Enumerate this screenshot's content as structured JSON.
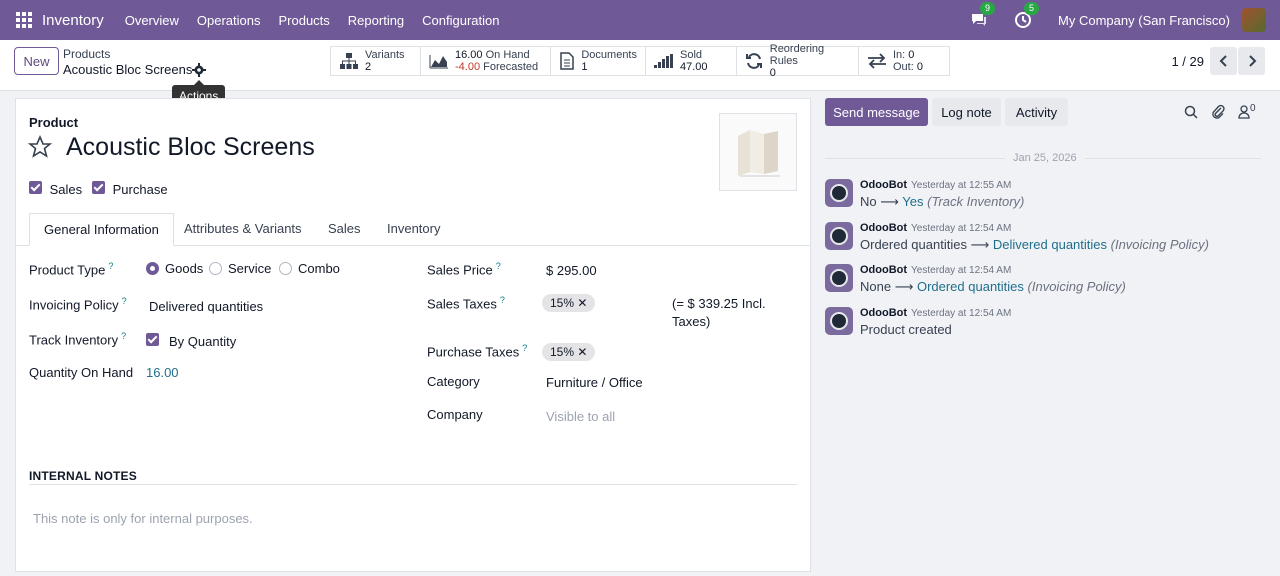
{
  "nav": {
    "brand": "Inventory",
    "menus": [
      "Overview",
      "Operations",
      "Products",
      "Reporting",
      "Configuration"
    ],
    "messages_count": "9",
    "activities_count": "5",
    "company": "My Company (San Francisco)"
  },
  "control": {
    "new_label": "New",
    "breadcrumb_parent": "Products",
    "breadcrumb_current": "Acoustic Bloc Screens",
    "tooltip": "Actions",
    "stats": {
      "variants_label": "Variants",
      "variants_value": "2",
      "onhand_value": "16.00",
      "onhand_label": "On Hand",
      "forecast_value": "-4.00",
      "forecast_label": "Forecasted",
      "documents_label": "Documents",
      "documents_value": "1",
      "sold_label": "Sold",
      "sold_value": "47.00",
      "reorder_label": "Reordering Rules",
      "reorder_value": "0",
      "in_label": "In:",
      "in_value": "0",
      "out_label": "Out:",
      "out_value": "0"
    },
    "pager": "1 / 29"
  },
  "form": {
    "product_label": "Product",
    "name": "Acoustic Bloc Screens",
    "sales_check": "Sales",
    "purchase_check": "Purchase",
    "tabs": [
      "General Information",
      "Attributes & Variants",
      "Sales",
      "Inventory"
    ],
    "left": {
      "product_type_label": "Product Type",
      "type_options": [
        "Goods",
        "Service",
        "Combo"
      ],
      "invoicing_policy_label": "Invoicing Policy",
      "invoicing_policy_value": "Delivered quantities",
      "track_inventory_label": "Track Inventory",
      "track_inventory_value": "By Quantity",
      "qty_on_hand_label": "Quantity On Hand",
      "qty_on_hand_value": "16.00"
    },
    "right": {
      "sales_price_label": "Sales Price",
      "sales_price_value": "$ 295.00",
      "sales_taxes_label": "Sales Taxes",
      "sales_tax_tag": "15%",
      "incl_taxes_line1": "(= $ 339.25 Incl.",
      "incl_taxes_line2": "Taxes)",
      "purchase_taxes_label": "Purchase Taxes",
      "purchase_tax_tag": "15%",
      "category_label": "Category",
      "category_value": "Furniture / Office",
      "company_label": "Company",
      "company_placeholder": "Visible to all"
    },
    "notes_title": "INTERNAL NOTES",
    "notes_placeholder": "This note is only for internal purposes."
  },
  "chatter": {
    "send_message": "Send message",
    "log_note": "Log note",
    "activity": "Activity",
    "followers_count": "0",
    "date": "Jan 25, 2026",
    "messages": [
      {
        "author": "OdooBot",
        "time": "Yesterday at 12:55 AM",
        "old": "No",
        "new": "Yes",
        "field": "(Track Inventory)"
      },
      {
        "author": "OdooBot",
        "time": "Yesterday at 12:54 AM",
        "old": "Ordered quantities",
        "new": "Delivered quantities",
        "field": "(Invoicing Policy)"
      },
      {
        "author": "OdooBot",
        "time": "Yesterday at 12:54 AM",
        "old": "None",
        "new": "Ordered quantities",
        "field": "(Invoicing Policy)"
      },
      {
        "author": "OdooBot",
        "time": "Yesterday at 12:54 AM",
        "text": "Product created"
      }
    ]
  }
}
